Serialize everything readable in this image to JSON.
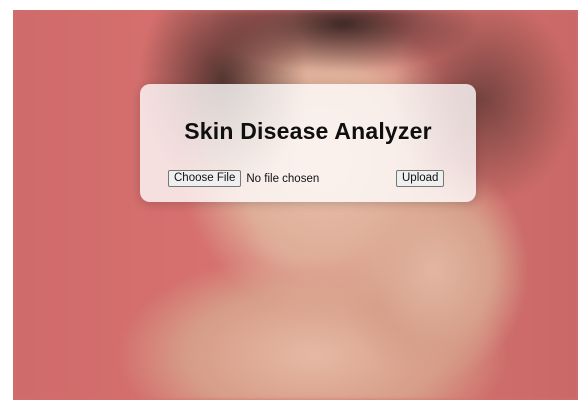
{
  "page": {
    "title": "Skin Disease Analyzer"
  },
  "form": {
    "choose_file_label": "Choose File",
    "file_status": "No file chosen",
    "upload_label": "Upload"
  },
  "colors": {
    "background_accent": "#d2716f",
    "card_background": "rgba(255,255,255,0.78)",
    "title_color": "#0f0f0f"
  }
}
